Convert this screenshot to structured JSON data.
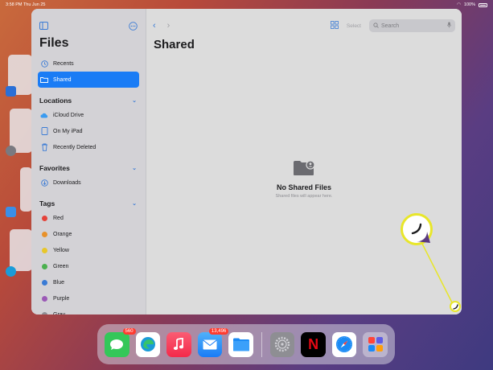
{
  "status_bar": {
    "time_date": "3:58 PM  Thu Jun 25",
    "battery": "100%"
  },
  "sidebar": {
    "title": "Files",
    "items": [
      {
        "label": "Recents",
        "icon": "clock-icon"
      },
      {
        "label": "Shared",
        "icon": "shared-folder-icon",
        "selected": true
      }
    ],
    "locations": {
      "header": "Locations",
      "items": [
        {
          "label": "iCloud Drive",
          "icon": "cloud-icon"
        },
        {
          "label": "On My iPad",
          "icon": "ipad-icon"
        },
        {
          "label": "Recently Deleted",
          "icon": "trash-icon"
        }
      ]
    },
    "favorites": {
      "header": "Favorites",
      "items": [
        {
          "label": "Downloads",
          "icon": "download-icon"
        }
      ]
    },
    "tags": {
      "header": "Tags",
      "items": [
        {
          "label": "Red",
          "color": "#e5423a"
        },
        {
          "label": "Orange",
          "color": "#e8912a"
        },
        {
          "label": "Yellow",
          "color": "#e8c72a"
        },
        {
          "label": "Green",
          "color": "#4bb04f"
        },
        {
          "label": "Blue",
          "color": "#3a7bd5"
        },
        {
          "label": "Purple",
          "color": "#9b59b6"
        },
        {
          "label": "Gray",
          "color": "#8e8e93"
        }
      ]
    }
  },
  "toolbar": {
    "select_label": "Select",
    "search_placeholder": "Search"
  },
  "main": {
    "title": "Shared",
    "empty_title": "No Shared Files",
    "empty_subtitle": "Shared files will appear here."
  },
  "dock": {
    "messages_badge": "560",
    "mail_badge": "13,496",
    "netflix_label": "N"
  }
}
